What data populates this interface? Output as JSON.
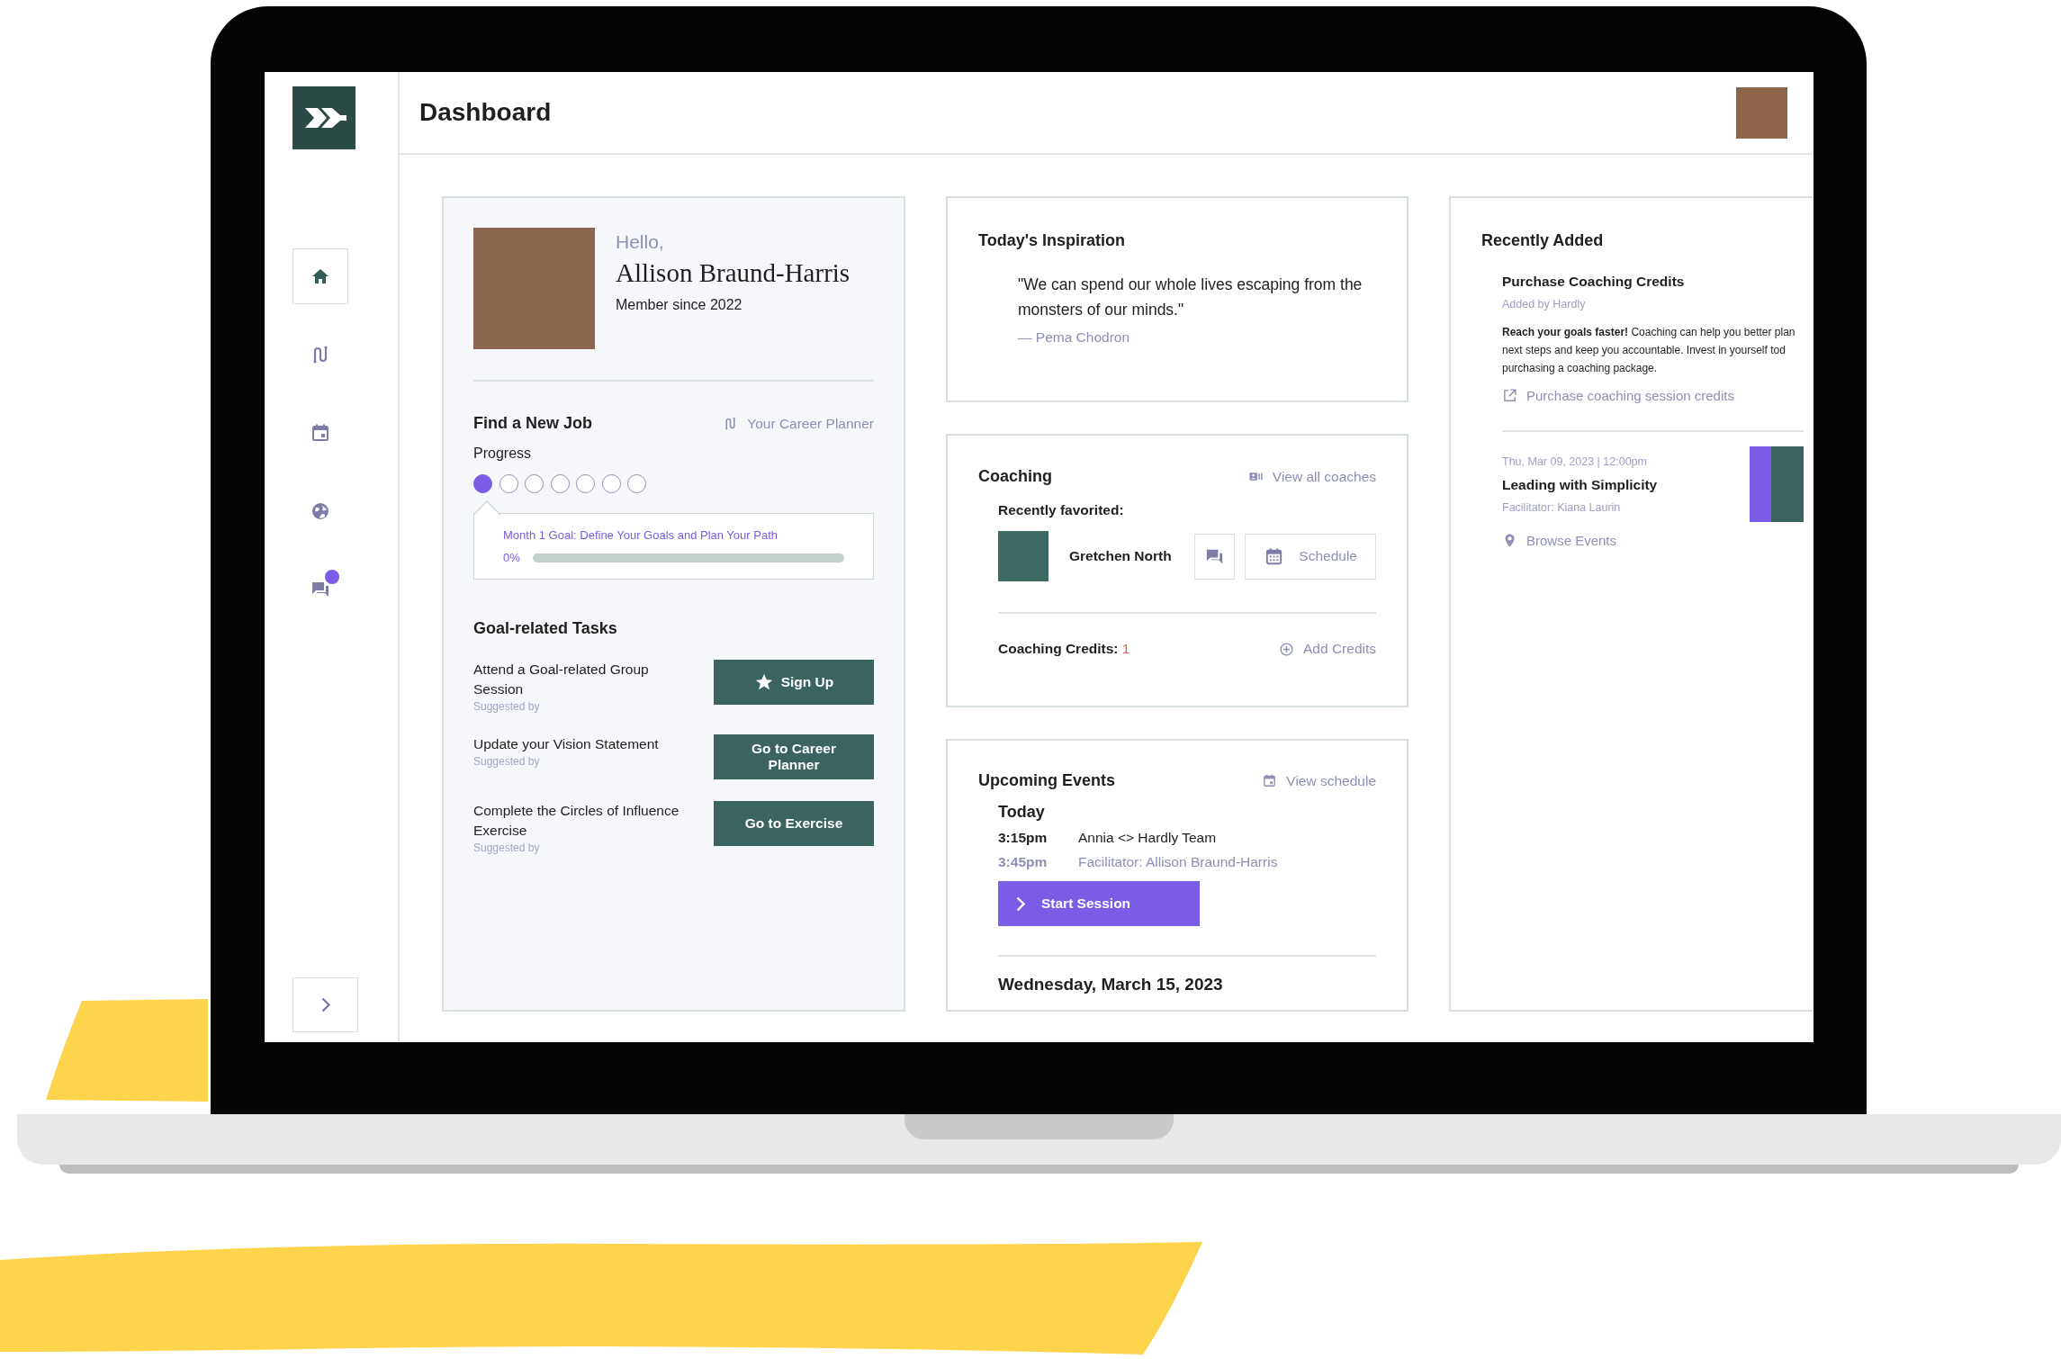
{
  "sidebar": {
    "items": [
      {
        "kind": "home",
        "selected": true,
        "notification": false
      },
      {
        "kind": "route",
        "selected": false,
        "notification": false
      },
      {
        "kind": "calendar",
        "selected": false,
        "notification": false
      },
      {
        "kind": "globe",
        "selected": false,
        "notification": false
      },
      {
        "kind": "chat",
        "selected": false,
        "notification": true
      }
    ]
  },
  "header": {
    "title": "Dashboard"
  },
  "profile": {
    "greeting": "Hello,",
    "name": "Allison Braund-Harris",
    "member_since": "Member since 2022"
  },
  "goal": {
    "title": "Find a New Job",
    "planner_link": "Your Career Planner",
    "progress_label": "Progress",
    "steps": [
      {
        "done": true
      },
      {
        "done": false
      },
      {
        "done": false
      },
      {
        "done": false
      },
      {
        "done": false
      },
      {
        "done": false
      },
      {
        "done": false
      }
    ],
    "month_goal": "Month 1 Goal: Define Your Goals and Plan Your Path",
    "percent": "0%",
    "level": 0
  },
  "tasks": {
    "title": "Goal-related Tasks",
    "items": [
      {
        "text": "Attend a Goal-related Group Session",
        "suggested": "Suggested by",
        "button": "Sign Up",
        "kind": "star"
      },
      {
        "text": "Update your Vision Statement",
        "suggested": "Suggested by",
        "button": "Go to Career Planner",
        "kind": "plain"
      },
      {
        "text": "Complete the Circles of Influence Exercise",
        "suggested": "Suggested by",
        "button": "Go to Exercise",
        "kind": "plain"
      }
    ]
  },
  "inspiration": {
    "title": "Today's Inspiration",
    "quote": "\"We can spend our whole lives escaping from the monsters of our minds.\"",
    "author": "— Pema Chodron"
  },
  "coaching": {
    "title": "Coaching",
    "link": "View all coaches",
    "favorited_label": "Recently favorited:",
    "coach": {
      "name": "Gretchen North",
      "schedule": "Schedule"
    },
    "credits_label": "Coaching Credits:",
    "credits": "1",
    "add": "Add Credits"
  },
  "events": {
    "title": "Upcoming Events",
    "link": "View schedule",
    "groups": [
      {
        "day": "Today",
        "items": [
          {
            "start": "3:15pm",
            "end": "3:45pm",
            "title": "Annia <> Hardly Team",
            "facilitator": "Facilitator: Allison Braund-Harris",
            "action": "Start Session"
          }
        ]
      },
      {
        "day": "Wednesday, March 15, 2023"
      }
    ]
  },
  "recently_added": {
    "title": "Recently Added",
    "items": [
      {
        "kind": "offer",
        "title": "Purchase Coaching Credits",
        "meta": "Added by Hardly",
        "description": "**Reach your goals faster!** Coaching can help you better plan next steps and keep you accountable. Invest in yourself tod purchasing a coaching package.",
        "link": "Purchase coaching session credits"
      },
      {
        "kind": "event",
        "date": "Thu, Mar 09, 2023 | 12:00pm",
        "title": "Leading with Simplicity",
        "meta": "Facilitator: Kiana Laurin",
        "link": "Browse Events"
      }
    ]
  }
}
